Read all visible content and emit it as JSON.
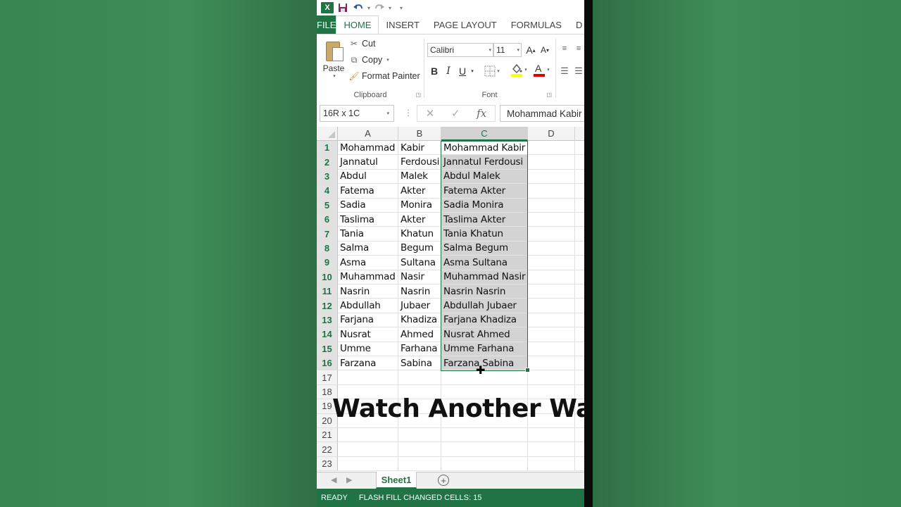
{
  "quick_access": {
    "excel_letter": "X",
    "save_icon": "save-icon",
    "undo_icon": "undo-icon",
    "redo_icon": "redo-icon"
  },
  "tabs": [
    "FILE",
    "HOME",
    "INSERT",
    "PAGE LAYOUT",
    "FORMULAS",
    "D"
  ],
  "active_tab": "HOME",
  "ribbon": {
    "clipboard": {
      "paste": "Paste",
      "cut": "Cut",
      "copy": "Copy",
      "format_painter": "Format Painter",
      "label": "Clipboard"
    },
    "font": {
      "name": "Calibri",
      "size": "11",
      "label": "Font",
      "bold": "B",
      "italic": "I",
      "underline": "U",
      "grow": "A",
      "shrink": "A"
    }
  },
  "formula_bar": {
    "name_box": "16R x 1C",
    "value": "Mohammad Kabir"
  },
  "columns": [
    "A",
    "B",
    "C",
    "D"
  ],
  "selected_column": "C",
  "rows": [
    {
      "n": "1",
      "a": "Mohammad",
      "b": "Kabir",
      "c": "Mohammad Kabir"
    },
    {
      "n": "2",
      "a": "Jannatul",
      "b": "Ferdousi",
      "c": "Jannatul Ferdousi"
    },
    {
      "n": "3",
      "a": "Abdul",
      "b": "Malek",
      "c": "Abdul Malek"
    },
    {
      "n": "4",
      "a": "Fatema",
      "b": "Akter",
      "c": "Fatema Akter"
    },
    {
      "n": "5",
      "a": "Sadia",
      "b": "Monira",
      "c": "Sadia Monira"
    },
    {
      "n": "6",
      "a": "Taslima",
      "b": "Akter",
      "c": "Taslima Akter"
    },
    {
      "n": "7",
      "a": "Tania",
      "b": "Khatun",
      "c": "Tania Khatun"
    },
    {
      "n": "8",
      "a": "Salma",
      "b": "Begum",
      "c": "Salma Begum"
    },
    {
      "n": "9",
      "a": "Asma",
      "b": "Sultana",
      "c": "Asma Sultana"
    },
    {
      "n": "10",
      "a": "Muhammad",
      "b": "Nasir",
      "c": "Muhammad Nasir"
    },
    {
      "n": "11",
      "a": "Nasrin",
      "b": "Nasrin",
      "c": "Nasrin Nasrin"
    },
    {
      "n": "12",
      "a": "Abdullah",
      "b": "Jubaer",
      "c": "Abdullah Jubaer"
    },
    {
      "n": "13",
      "a": "Farjana",
      "b": "Khadiza",
      "c": "Farjana Khadiza"
    },
    {
      "n": "14",
      "a": "Nusrat",
      "b": "Ahmed",
      "c": "Nusrat Ahmed"
    },
    {
      "n": "15",
      "a": "Umme",
      "b": "Farhana",
      "c": "Umme Farhana"
    },
    {
      "n": "16",
      "a": "Farzana",
      "b": "Sabina",
      "c": "Farzana Sabina"
    },
    {
      "n": "17",
      "a": "",
      "b": "",
      "c": ""
    },
    {
      "n": "18",
      "a": "",
      "b": "",
      "c": ""
    },
    {
      "n": "19",
      "a": "",
      "b": "",
      "c": ""
    },
    {
      "n": "20",
      "a": "",
      "b": "",
      "c": ""
    },
    {
      "n": "21",
      "a": "",
      "b": "",
      "c": ""
    },
    {
      "n": "22",
      "a": "",
      "b": "",
      "c": ""
    },
    {
      "n": "23",
      "a": "",
      "b": "",
      "c": ""
    }
  ],
  "overlay_text": "Watch Another Way",
  "sheet_tab": "Sheet1",
  "status": {
    "ready": "READY",
    "message": "FLASH FILL CHANGED CELLS: 15"
  },
  "colors": {
    "accent": "#217346",
    "background": "#3d8a55",
    "selection_fill": "#d3d3d3"
  }
}
